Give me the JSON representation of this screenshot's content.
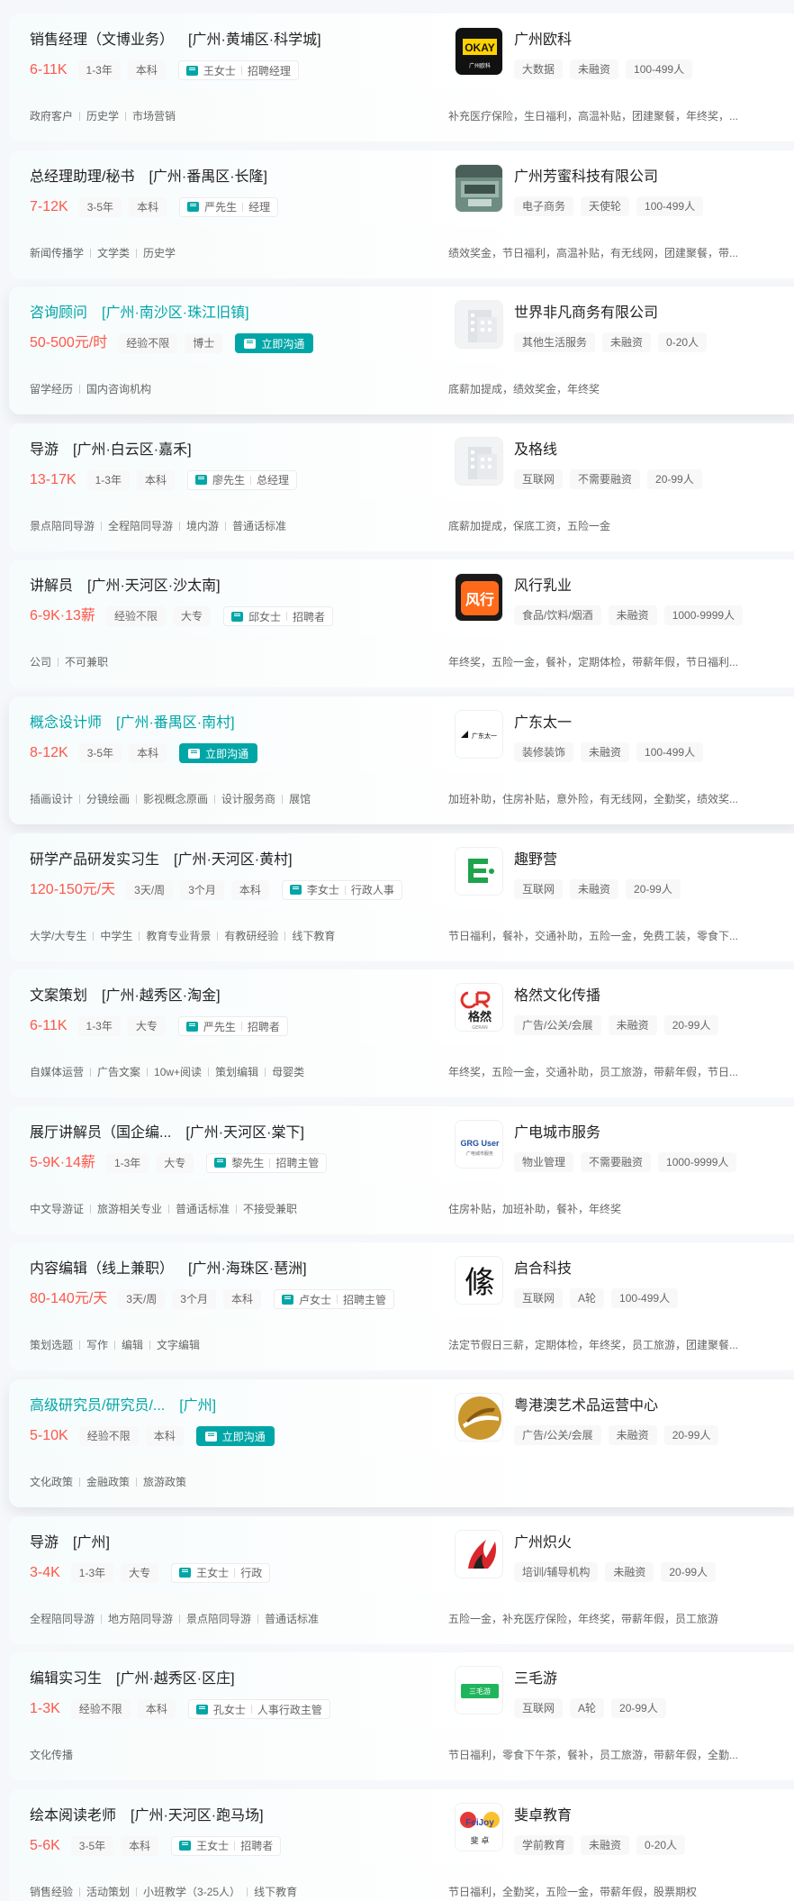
{
  "jobs": [
    {
      "title": "销售经理（文博业务）",
      "area": "[广州·黄埔区·科学城]",
      "salary": "6-11K",
      "tags": [
        "1-3年",
        "本科"
      ],
      "recruiter": "王女士",
      "recruiter_role": "招聘经理",
      "chat_label": "",
      "skills": [
        "政府客户",
        "历史学",
        "市场营销"
      ],
      "company": "广州欧科",
      "ctags": [
        "大数据",
        "未融资",
        "100-499人"
      ],
      "benefits": "补充医疗保险，生日福利，高温补贴，团建聚餐，年终奖，...",
      "logo": "okay"
    },
    {
      "title": "总经理助理/秘书",
      "area": "[广州·番禺区·长隆]",
      "salary": "7-12K",
      "tags": [
        "3-5年",
        "本科"
      ],
      "recruiter": "严先生",
      "recruiter_role": "经理",
      "chat_label": "",
      "skills": [
        "新闻传播学",
        "文学类",
        "历史学"
      ],
      "company": "广州芳蜜科技有限公司",
      "ctags": [
        "电子商务",
        "天使轮",
        "100-499人"
      ],
      "benefits": "绩效奖金，节日福利，高温补贴，有无线网，团建聚餐，带...",
      "logo": "office"
    },
    {
      "title": "咨询顾问",
      "area": "[广州·南沙区·珠江旧镇]",
      "salary": "50-500元/时",
      "tags": [
        "经验不限",
        "博士"
      ],
      "recruiter": "",
      "recruiter_role": "",
      "chat_label": "立即沟通",
      "skills": [
        "留学经历",
        "国内咨询机构"
      ],
      "company": "世界非凡商务有限公司",
      "ctags": [
        "其他生活服务",
        "未融资",
        "0-20人"
      ],
      "benefits": "底薪加提成，绩效奖金，年终奖",
      "logo": "building"
    },
    {
      "title": "导游",
      "area": "[广州·白云区·嘉禾]",
      "salary": "13-17K",
      "tags": [
        "1-3年",
        "本科"
      ],
      "recruiter": "廖先生",
      "recruiter_role": "总经理",
      "chat_label": "",
      "skills": [
        "景点陪同导游",
        "全程陪同导游",
        "境内游",
        "普通话标准"
      ],
      "company": "及格线",
      "ctags": [
        "互联网",
        "不需要融资",
        "20-99人"
      ],
      "benefits": "底薪加提成，保底工资，五险一金",
      "logo": "building"
    },
    {
      "title": "讲解员",
      "area": "[广州·天河区·沙太南]",
      "salary": "6-9K·13薪",
      "tags": [
        "经验不限",
        "大专"
      ],
      "recruiter": "邱女士",
      "recruiter_role": "招聘者",
      "chat_label": "",
      "skills": [
        "公司",
        "不可兼职"
      ],
      "company": "风行乳业",
      "ctags": [
        "食品/饮料/烟酒",
        "未融资",
        "1000-9999人"
      ],
      "benefits": "年终奖，五险一金，餐补，定期体检，带薪年假，节日福利...",
      "logo": "fengxing"
    },
    {
      "title": "概念设计师",
      "area": "[广州·番禺区·南村]",
      "salary": "8-12K",
      "tags": [
        "3-5年",
        "本科"
      ],
      "recruiter": "",
      "recruiter_role": "",
      "chat_label": "立即沟通",
      "skills": [
        "插画设计",
        "分镜绘画",
        "影视概念原画",
        "设计服务商",
        "展馆"
      ],
      "company": "广东太一",
      "ctags": [
        "装修装饰",
        "未融资",
        "100-499人"
      ],
      "benefits": "加班补助，住房补贴，意外险，有无线网，全勤奖，绩效奖...",
      "logo": "taiyi"
    },
    {
      "title": "研学产品研发实习生",
      "area": "[广州·天河区·黄村]",
      "salary": "120-150元/天",
      "tags": [
        "3天/周",
        "3个月",
        "本科"
      ],
      "recruiter": "李女士",
      "recruiter_role": "行政人事",
      "chat_label": "",
      "skills": [
        "大学/大专生",
        "中学生",
        "教育专业背景",
        "有教研经验",
        "线下教育"
      ],
      "company": "趣野营",
      "ctags": [
        "互联网",
        "未融资",
        "20-99人"
      ],
      "benefits": "节日福利，餐补，交通补助，五险一金，免费工装，零食下...",
      "logo": "quyeying"
    },
    {
      "title": "文案策划",
      "area": "[广州·越秀区·淘金]",
      "salary": "6-11K",
      "tags": [
        "1-3年",
        "大专"
      ],
      "recruiter": "严先生",
      "recruiter_role": "招聘者",
      "chat_label": "",
      "skills": [
        "自媒体运营",
        "广告文案",
        "10w+阅读",
        "策划编辑",
        "母婴类"
      ],
      "company": "格然文化传播",
      "ctags": [
        "广告/公关/会展",
        "未融资",
        "20-99人"
      ],
      "benefits": "年终奖，五险一金，交通补助，员工旅游，带薪年假，节日...",
      "logo": "geran"
    },
    {
      "title": "展厅讲解员（国企编...",
      "area": "[广州·天河区·棠下]",
      "salary": "5-9K·14薪",
      "tags": [
        "1-3年",
        "大专"
      ],
      "recruiter": "黎先生",
      "recruiter_role": "招聘主管",
      "chat_label": "",
      "skills": [
        "中文导游证",
        "旅游相关专业",
        "普通话标准",
        "不接受兼职"
      ],
      "company": "广电城市服务",
      "ctags": [
        "物业管理",
        "不需要融资",
        "1000-9999人"
      ],
      "benefits": "住房补贴，加班补助，餐补，年终奖",
      "logo": "grg"
    },
    {
      "title": "内容编辑（线上兼职）",
      "area": "[广州·海珠区·琶洲]",
      "salary": "80-140元/天",
      "tags": [
        "3天/周",
        "3个月",
        "本科"
      ],
      "recruiter": "卢女士",
      "recruiter_role": "招聘主管",
      "chat_label": "",
      "skills": [
        "策划选题",
        "写作",
        "编辑",
        "文字编辑"
      ],
      "company": "启合科技",
      "ctags": [
        "互联网",
        "A轮",
        "100-499人"
      ],
      "benefits": "法定节假日三薪，定期体检，年终奖，员工旅游，团建聚餐...",
      "logo": "qihe"
    },
    {
      "title": "高级研究员/研究员/...",
      "area": "[广州]",
      "salary": "5-10K",
      "tags": [
        "经验不限",
        "本科"
      ],
      "recruiter": "",
      "recruiter_role": "",
      "chat_label": "立即沟通",
      "skills": [
        "文化政策",
        "金融政策",
        "旅游政策"
      ],
      "company": "粤港澳艺术品运营中心",
      "ctags": [
        "广告/公关/会展",
        "未融资",
        "20-99人"
      ],
      "benefits": "",
      "logo": "yuegang"
    },
    {
      "title": "导游",
      "area": "[广州]",
      "salary": "3-4K",
      "tags": [
        "1-3年",
        "大专"
      ],
      "recruiter": "王女士",
      "recruiter_role": "行政",
      "chat_label": "",
      "skills": [
        "全程陪同导游",
        "地方陪同导游",
        "景点陪同导游",
        "普通话标准"
      ],
      "company": "广州炽火",
      "ctags": [
        "培训/辅导机构",
        "未融资",
        "20-99人"
      ],
      "benefits": "五险一金，补充医疗保险，年终奖，带薪年假，员工旅游",
      "logo": "chihuo"
    },
    {
      "title": "编辑实习生",
      "area": "[广州·越秀区·区庄]",
      "salary": "1-3K",
      "tags": [
        "经验不限",
        "本科"
      ],
      "recruiter": "孔女士",
      "recruiter_role": "人事行政主管",
      "chat_label": "",
      "skills": [
        "文化传播"
      ],
      "company": "三毛游",
      "ctags": [
        "互联网",
        "A轮",
        "20-99人"
      ],
      "benefits": "节日福利，零食下午茶，餐补，员工旅游，带薪年假，全勤...",
      "logo": "sanmaoyou"
    },
    {
      "title": "绘本阅读老师",
      "area": "[广州·天河区·跑马场]",
      "salary": "5-6K",
      "tags": [
        "3-5年",
        "本科"
      ],
      "recruiter": "王女士",
      "recruiter_role": "招聘者",
      "chat_label": "",
      "skills": [
        "销售经验",
        "活动策划",
        "小班教学（3-25人）",
        "线下教育"
      ],
      "company": "斐卓教育",
      "ctags": [
        "学前教育",
        "未融资",
        "0-20人"
      ],
      "benefits": "节日福利，全勤奖，五险一金，带薪年假，股票期权",
      "logo": "feizhuo"
    }
  ],
  "logo_text": {
    "okay": "OKAY",
    "okay_sub": "广州欧科",
    "fengxing": "风行",
    "taiyi": "广东太一",
    "geran": "格然",
    "geran_sub": "GERAN",
    "grg": "GRG User",
    "grg_sub": "广电城市服务",
    "qihe": "絛",
    "sanmaoyou": "三毛游",
    "feizhuo": "FeiJoy",
    "feizhuo_sub": "斐 卓"
  },
  "colors": {
    "accent": "#00a6a7",
    "salary": "#fe574a"
  }
}
